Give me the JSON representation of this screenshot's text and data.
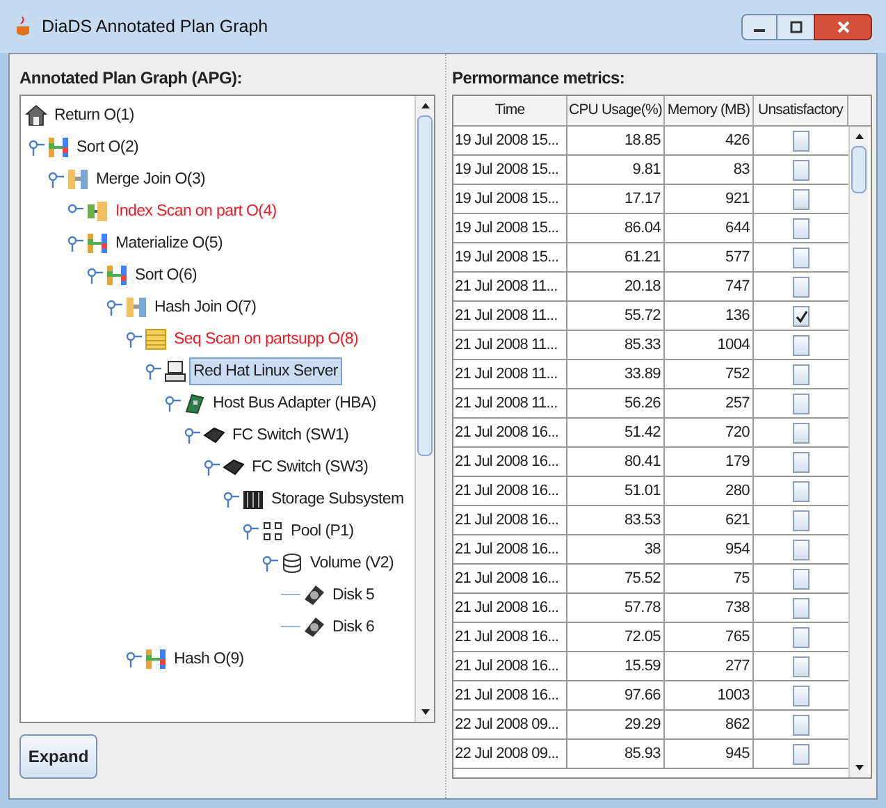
{
  "window": {
    "title": "DiaDS Annotated Plan Graph"
  },
  "plan_panel": {
    "label": "Annotated Plan Graph (APG):",
    "nodes": [
      {
        "label": "Return O(1)",
        "kind": "root",
        "alert": false,
        "selected": false,
        "children": [
          {
            "label": "Sort O(2)",
            "kind": "operator",
            "alert": false,
            "selected": false,
            "expanded": true,
            "children": [
              {
                "label": "Merge Join O(3)",
                "kind": "join",
                "alert": false,
                "selected": false,
                "expanded": true,
                "children": [
                  {
                    "label": "Index Scan on part O(4)",
                    "kind": "scan",
                    "alert": true,
                    "selected": false,
                    "expanded": false
                  },
                  {
                    "label": "Materialize O(5)",
                    "kind": "operator",
                    "alert": false,
                    "selected": false,
                    "expanded": true,
                    "children": [
                      {
                        "label": "Sort O(6)",
                        "kind": "operator",
                        "alert": false,
                        "selected": false,
                        "expanded": true,
                        "children": [
                          {
                            "label": "Hash Join O(7)",
                            "kind": "join",
                            "alert": false,
                            "selected": false,
                            "expanded": true,
                            "children": [
                              {
                                "label": "Seq Scan on partsupp O(8)",
                                "kind": "table",
                                "alert": true,
                                "selected": false,
                                "expanded": true,
                                "children": [
                                  {
                                    "label": "Red Hat Linux Server",
                                    "kind": "server",
                                    "alert": false,
                                    "selected": true,
                                    "expanded": true,
                                    "children": [
                                      {
                                        "label": "Host Bus Adapter (HBA)",
                                        "kind": "adapter",
                                        "alert": false,
                                        "selected": false,
                                        "expanded": true,
                                        "children": [
                                          {
                                            "label": "FC Switch (SW1)",
                                            "kind": "switch",
                                            "alert": false,
                                            "selected": false,
                                            "expanded": true,
                                            "children": [
                                              {
                                                "label": "FC Switch (SW3)",
                                                "kind": "switch",
                                                "alert": false,
                                                "selected": false,
                                                "expanded": true,
                                                "children": [
                                                  {
                                                    "label": "Storage Subsystem",
                                                    "kind": "storage",
                                                    "alert": false,
                                                    "selected": false,
                                                    "expanded": true,
                                                    "children": [
                                                      {
                                                        "label": "Pool (P1)",
                                                        "kind": "pool",
                                                        "alert": false,
                                                        "selected": false,
                                                        "expanded": true,
                                                        "children": [
                                                          {
                                                            "label": "Volume (V2)",
                                                            "kind": "volume",
                                                            "alert": false,
                                                            "selected": false,
                                                            "expanded": true,
                                                            "children": [
                                                              {
                                                                "label": "Disk 5",
                                                                "kind": "disk",
                                                                "alert": false,
                                                                "selected": false
                                                              },
                                                              {
                                                                "label": "Disk 6",
                                                                "kind": "disk",
                                                                "alert": false,
                                                                "selected": false
                                                              }
                                                            ]
                                                          }
                                                        ]
                                                      }
                                                    ]
                                                  }
                                                ]
                                              }
                                            ]
                                          }
                                        ]
                                      }
                                    ]
                                  }
                                ]
                              },
                              {
                                "label": "Hash O(9)",
                                "kind": "operator",
                                "alert": false,
                                "selected": false,
                                "expanded": true
                              }
                            ]
                          }
                        ]
                      }
                    ]
                  }
                ]
              }
            ]
          }
        ]
      }
    ]
  },
  "expand_button": {
    "label": "Expand"
  },
  "metrics": {
    "label": "Permormance metrics:",
    "columns": [
      "Time",
      "CPU Usage(%)",
      "Memory (MB)",
      "Unsatisfactory"
    ],
    "rows": [
      {
        "time": "19 Jul 2008 15...",
        "cpu": "18.85",
        "memory": "426",
        "checked": false
      },
      {
        "time": "19 Jul 2008 15...",
        "cpu": "9.81",
        "memory": "83",
        "checked": false
      },
      {
        "time": "19 Jul 2008 15...",
        "cpu": "17.17",
        "memory": "921",
        "checked": false
      },
      {
        "time": "19 Jul 2008 15...",
        "cpu": "86.04",
        "memory": "644",
        "checked": false
      },
      {
        "time": "19 Jul 2008 15...",
        "cpu": "61.21",
        "memory": "577",
        "checked": false
      },
      {
        "time": "21 Jul 2008 11...",
        "cpu": "20.18",
        "memory": "747",
        "checked": false
      },
      {
        "time": "21 Jul 2008 11...",
        "cpu": "55.72",
        "memory": "136",
        "checked": true
      },
      {
        "time": "21 Jul 2008 11...",
        "cpu": "85.33",
        "memory": "1004",
        "checked": false
      },
      {
        "time": "21 Jul 2008 11...",
        "cpu": "33.89",
        "memory": "752",
        "checked": false
      },
      {
        "time": "21 Jul 2008 11...",
        "cpu": "56.26",
        "memory": "257",
        "checked": false
      },
      {
        "time": "21 Jul 2008 16...",
        "cpu": "51.42",
        "memory": "720",
        "checked": false
      },
      {
        "time": "21 Jul 2008 16...",
        "cpu": "80.41",
        "memory": "179",
        "checked": false
      },
      {
        "time": "21 Jul 2008 16...",
        "cpu": "51.01",
        "memory": "280",
        "checked": false
      },
      {
        "time": "21 Jul 2008 16...",
        "cpu": "83.53",
        "memory": "621",
        "checked": false
      },
      {
        "time": "21 Jul 2008 16...",
        "cpu": "38",
        "memory": "954",
        "checked": false
      },
      {
        "time": "21 Jul 2008 16...",
        "cpu": "75.52",
        "memory": "75",
        "checked": false
      },
      {
        "time": "21 Jul 2008 16...",
        "cpu": "57.78",
        "memory": "738",
        "checked": false
      },
      {
        "time": "21 Jul 2008 16...",
        "cpu": "72.05",
        "memory": "765",
        "checked": false
      },
      {
        "time": "21 Jul 2008 16...",
        "cpu": "15.59",
        "memory": "277",
        "checked": false
      },
      {
        "time": "21 Jul 2008 16...",
        "cpu": "97.66",
        "memory": "1003",
        "checked": false
      },
      {
        "time": "22 Jul 2008 09...",
        "cpu": "29.29",
        "memory": "862",
        "checked": false
      },
      {
        "time": "22 Jul 2008 09...",
        "cpu": "85.93",
        "memory": "945",
        "checked": false
      }
    ]
  }
}
